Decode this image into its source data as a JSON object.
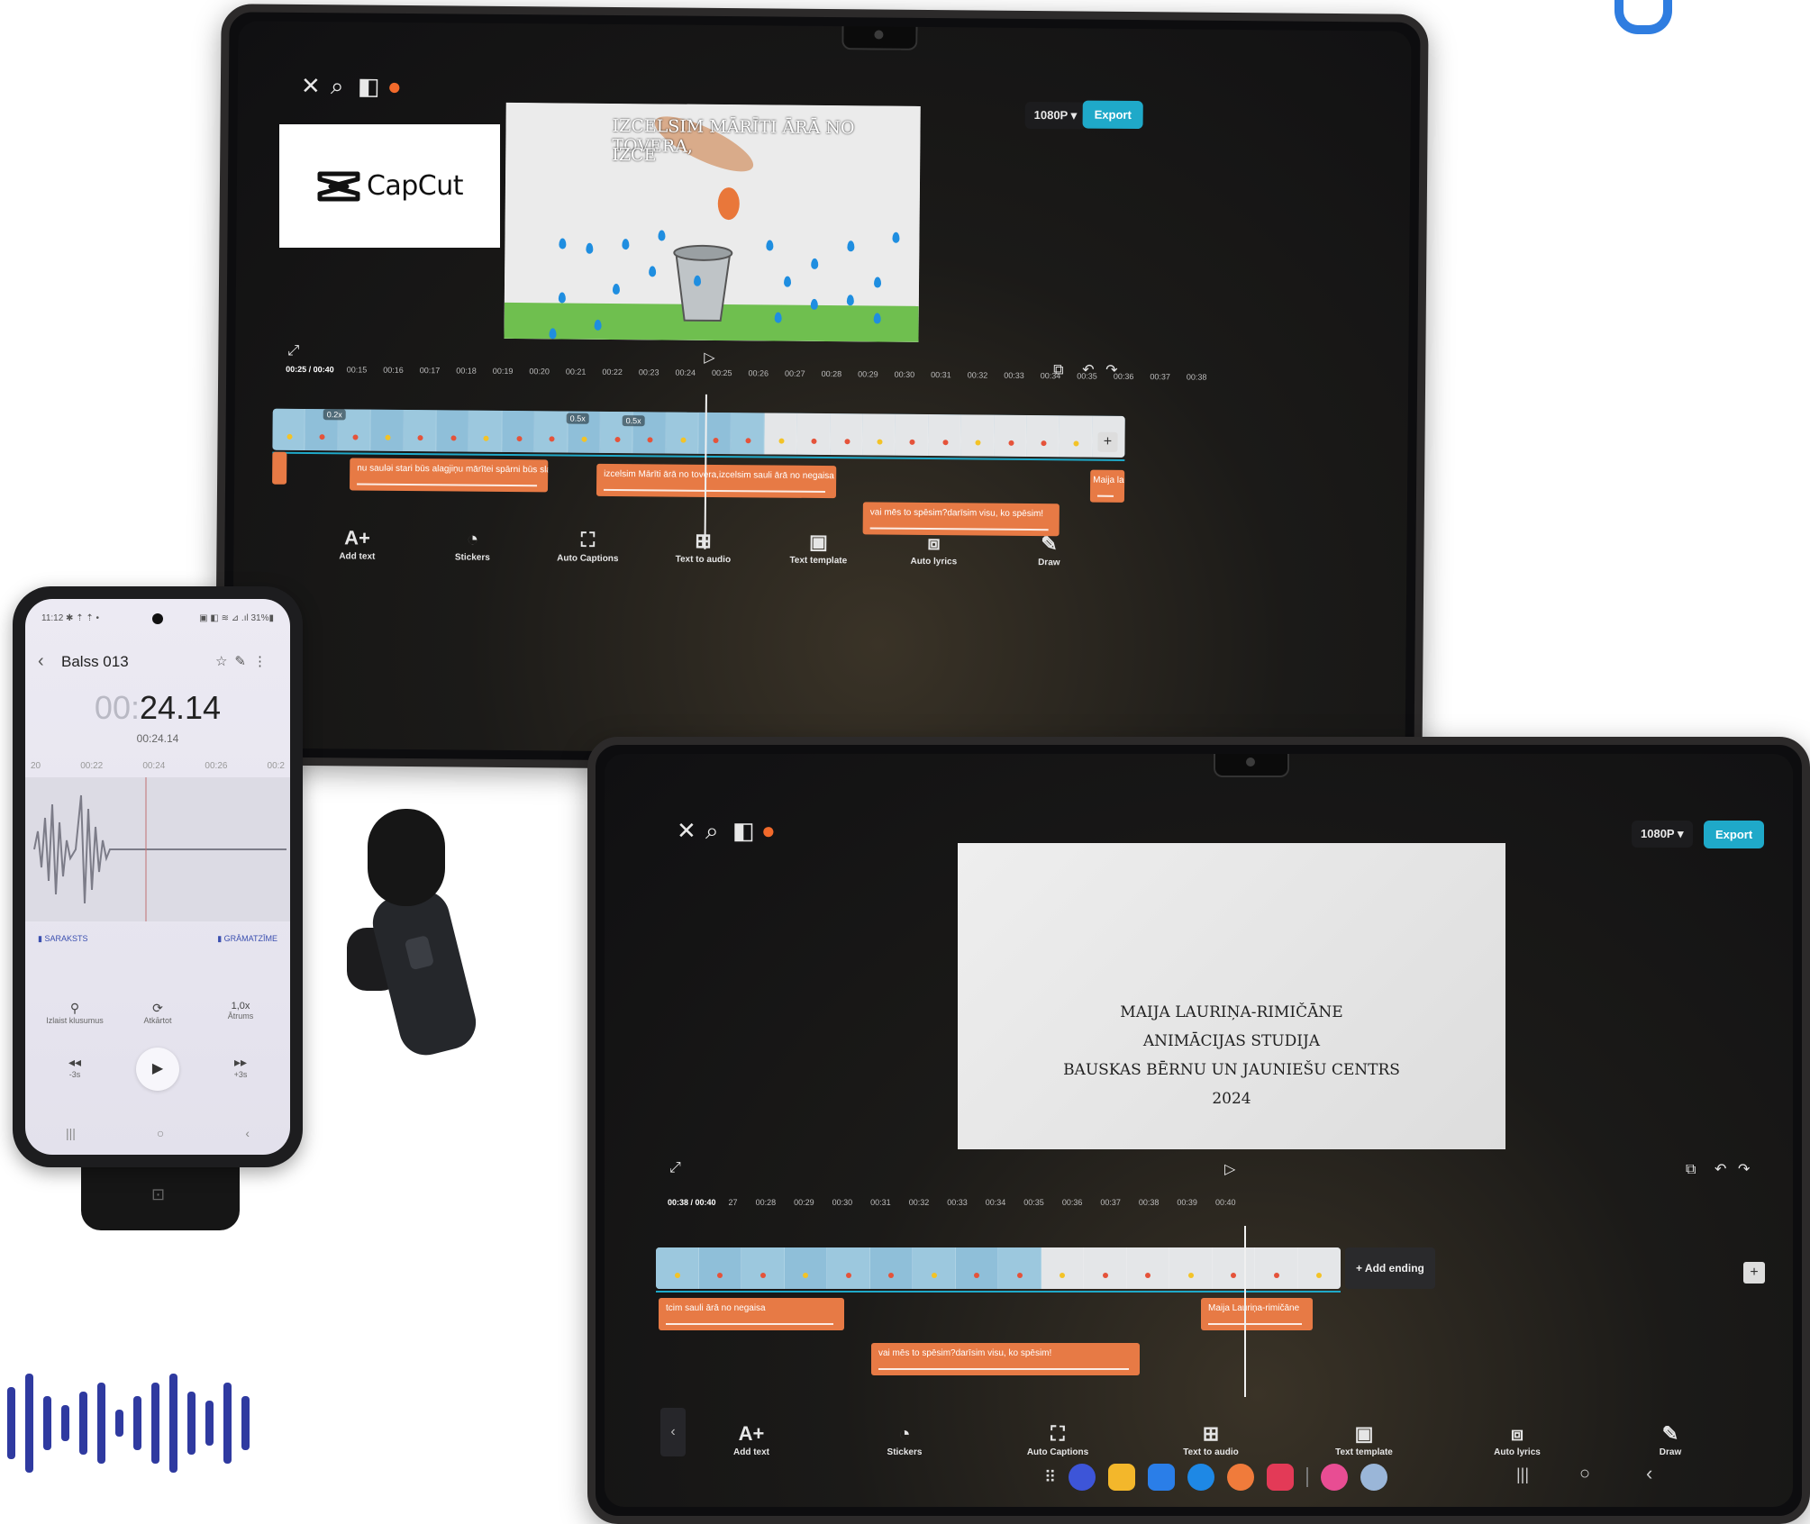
{
  "logo": {
    "text": "CapCut"
  },
  "tablet1": {
    "resolution": "1080P ▾",
    "export": "Export",
    "caption_top": "IZCELSIM MĀRĪTI ĀRĀ NO TOVERA,",
    "caption_bottom": "IZCE",
    "timecode": "00:25 / 00:40",
    "ruler": [
      "00:15",
      "00:16",
      "00:17",
      "00:18",
      "00:19",
      "00:20",
      "00:21",
      "00:22",
      "00:23",
      "00:24",
      "00:25",
      "00:26",
      "00:27",
      "00:28",
      "00:29",
      "00:30",
      "00:31",
      "00:32",
      "00:33",
      "00:34",
      "00:35",
      "00:36",
      "00:37",
      "00:38"
    ],
    "speed1": "0.2x",
    "speed2": "0.5x",
    "speed3": "0.5x",
    "clips": [
      "nu sauləi stari būs alagjiņu mārītei spārni būs slapji",
      "izcelsim Mārīti ārā no tovera,izcelsim sauli ārā no negaisa",
      "vai mēs to spēsim?darīsim visu, ko spēsim!",
      "Maija lau"
    ],
    "tools": [
      "Add text",
      "Stickers",
      "Auto Captions",
      "Text to audio",
      "Text template",
      "Auto lyrics",
      "Draw"
    ]
  },
  "tablet2": {
    "resolution": "1080P ▾",
    "export": "Export",
    "credits": [
      "MAIJA LAURIŅA-RIMIČĀNE",
      "ANIMĀCIJAS STUDIJA",
      "BAUSKAS BĒRNU UN JAUNIEŠU CENTRS",
      "2024"
    ],
    "timecode": "00:38 / 00:40",
    "ruler": [
      "27",
      "00:28",
      "00:29",
      "00:30",
      "00:31",
      "00:32",
      "00:33",
      "00:34",
      "00:35",
      "00:36",
      "00:37",
      "00:38",
      "00:39",
      "00:40"
    ],
    "add_ending": "+ Add ending",
    "clips": [
      "tcim sauli ārā no negaisa",
      "vai mēs to spēsim?darīsim visu, ko spēsim!",
      "Maija Lauriņa-rimičāne"
    ],
    "tools": [
      "Add text",
      "Stickers",
      "Auto Captions",
      "Text to audio",
      "Text template",
      "Auto lyrics",
      "Draw"
    ]
  },
  "phone": {
    "status_left": "11:12 ✱ ⇡ ⇡ •",
    "status_right": "▣ ◧ ≋ ⊿ .ıl 31%▮",
    "title": "Balss 013",
    "time_dim": "00:",
    "time_main": "24.14",
    "time_small": "00:24.14",
    "ticks": [
      "20",
      "00:22",
      "00:24",
      "00:26",
      "00:2"
    ],
    "label_left": "SARAKSTS",
    "label_right": "GRĀMATZĪME",
    "ctrl1_label": "Izlaist klusumus",
    "ctrl2_label": "Atkārtot",
    "ctrl3_value": "1,0x",
    "ctrl3_label": "Ātrums",
    "rew": "-3s",
    "fwd": "+3s"
  },
  "colors": {
    "accent": "#1fa9c9",
    "clip": "#e77a45",
    "brand_bars": "#2f3aa0"
  }
}
